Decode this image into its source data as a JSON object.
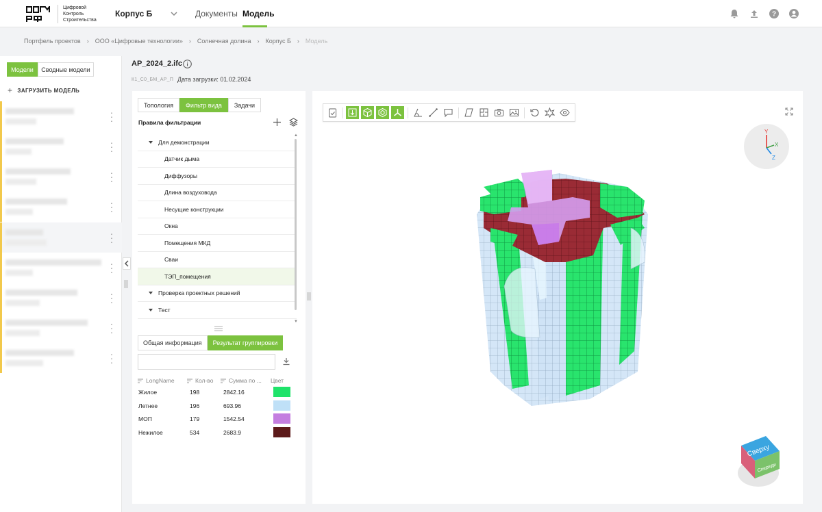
{
  "header": {
    "logo_text": [
      "Цифровой",
      "Контроль",
      "Строительства"
    ],
    "project": "Корпус Б",
    "nav": {
      "documents": "Документы",
      "model": "Модель"
    },
    "icons": [
      "bell-icon",
      "upload-icon",
      "help-icon",
      "account-icon"
    ]
  },
  "breadcrumb": [
    "Портфель проектов",
    "ООО «Цифровые технологии»",
    "Солнечная долина",
    "Корпус Б",
    "Модель"
  ],
  "left_panel": {
    "tabs": {
      "models": "Модели",
      "summary": "Сводные модели"
    },
    "upload_label": "ЗАГРУЗИТЬ МОДЕЛЬ"
  },
  "file": {
    "name": "AP_2024_2.ifc",
    "code": "К1_С0_БМ_АР_П",
    "date_label": "Дата загрузки: 01.02.2024"
  },
  "filter_panel": {
    "tabs": [
      "Топология",
      "Фильтр вида",
      "Задачи"
    ],
    "rules_title": "Правила фильтрации",
    "groups": [
      {
        "label": "Для демонстрации",
        "children": [
          "Датчик дыма",
          "Диффузоры",
          "Длина воздуховода",
          "Несущие конструкции",
          "Окна",
          "Помещения МКД",
          "Сваи",
          "ТЭП_помещения"
        ]
      },
      {
        "label": "Проверка проектных решений",
        "children": []
      },
      {
        "label": "Тест",
        "children": []
      }
    ],
    "bottom_tabs": [
      "Общая информация",
      "Результат группировки"
    ],
    "search_value": "",
    "table": {
      "headers": [
        "LongName",
        "Кол-во",
        "Сумма по ...",
        "Цвет"
      ],
      "rows": [
        {
          "name": "Жилое",
          "count": "198",
          "sum": "2842.16",
          "color": "#1fe36a"
        },
        {
          "name": "Летнее",
          "count": "196",
          "sum": "693.96",
          "color": "#bfe0f7"
        },
        {
          "name": "МОП",
          "count": "179",
          "sum": "1542.54",
          "color": "#c47ee0"
        },
        {
          "name": "Нежилое",
          "count": "534",
          "sum": "2683.9",
          "color": "#5c1a1a"
        }
      ]
    }
  },
  "viewer": {
    "toolbar": [
      "checklist-icon",
      "section-box-icon",
      "cube-icon",
      "cube-edges-icon",
      "axes-icon",
      "angle-measure-icon",
      "distance-measure-icon",
      "comment-icon",
      "plane-icon",
      "floorplan-icon",
      "camera-icon",
      "image-icon",
      "reset-icon",
      "explode-icon",
      "visibility-icon"
    ],
    "axes": {
      "y": "Y",
      "x": "X",
      "z": "Z"
    },
    "viewcube": {
      "top": "Сверху",
      "front": "Спереди"
    }
  },
  "colors": {
    "accent": "#7cc23f",
    "highlight": "#f1f8e9",
    "yellow_marker": "#f2c94c"
  }
}
